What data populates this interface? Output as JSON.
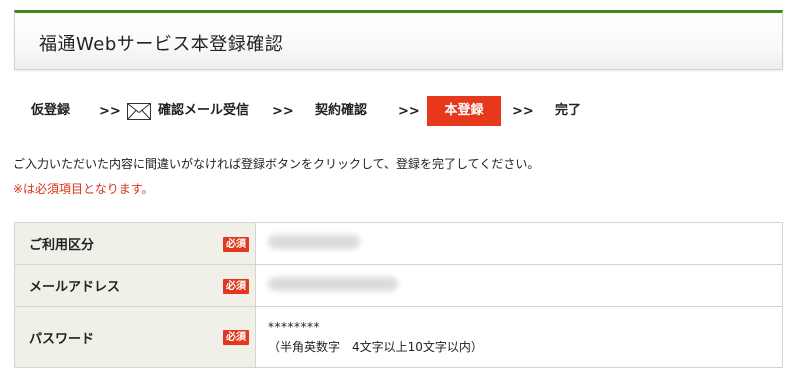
{
  "page": {
    "title": "福通Webサービス本登録確認"
  },
  "steps": {
    "items": [
      {
        "label": "仮登録"
      },
      {
        "label": "確認メール受信"
      },
      {
        "label": "契約確認"
      },
      {
        "label": "本登録"
      },
      {
        "label": "完了"
      }
    ],
    "separator": ">>",
    "active_index": 3,
    "active_color": "#e8381b"
  },
  "message": {
    "instruction": "ご入力いただいた内容に間違いがなければ登録ボタンをクリックして、登録を完了してください。",
    "required_note": "※は必須項目となります。"
  },
  "form": {
    "required_badge": "必須",
    "rows": [
      {
        "label": "ご利用区分",
        "value": ""
      },
      {
        "label": "メールアドレス",
        "value": ""
      },
      {
        "label": "パスワード",
        "value": "********",
        "note": "（半角英数字　4文字以上10文字以内）"
      }
    ]
  },
  "colors": {
    "brand_green": "#3f8a1d",
    "accent_red": "#e8381b",
    "required_text_red": "#d9301a",
    "header_cell_bg": "#f1f0e8"
  },
  "icons": {
    "step_mail": "envelope-icon"
  }
}
